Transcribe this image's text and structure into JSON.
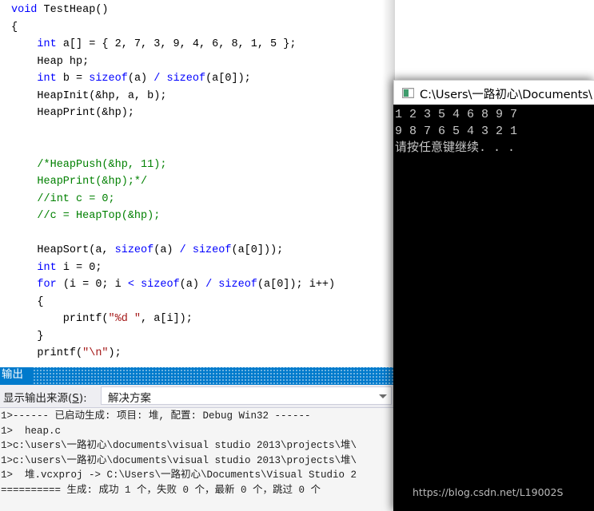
{
  "editor": {
    "language": "c",
    "colors": {
      "keyword": "#0000FF",
      "comment": "#008000",
      "string": "#A31515",
      "plain": "#000000",
      "background": "#FFFFFF"
    },
    "lines": [
      [
        {
          "t": "void ",
          "c": "kw"
        },
        {
          "t": "TestHeap()",
          "c": "pln"
        }
      ],
      [
        {
          "t": "{",
          "c": "pln"
        }
      ],
      [
        {
          "t": "    ",
          "c": "pln"
        },
        {
          "t": "int",
          "c": "kw"
        },
        {
          "t": " a[] = { 2, 7, 3, 9, 4, 6, 8, 1, 5 };",
          "c": "pln"
        }
      ],
      [
        {
          "t": "    Heap hp;",
          "c": "pln"
        }
      ],
      [
        {
          "t": "    ",
          "c": "pln"
        },
        {
          "t": "int",
          "c": "kw"
        },
        {
          "t": " b = ",
          "c": "pln"
        },
        {
          "t": "sizeof",
          "c": "kw"
        },
        {
          "t": "(a) ",
          "c": "pln"
        },
        {
          "t": "/",
          "c": "kw"
        },
        {
          "t": " ",
          "c": "pln"
        },
        {
          "t": "sizeof",
          "c": "kw"
        },
        {
          "t": "(a[0]);",
          "c": "pln"
        }
      ],
      [
        {
          "t": "    HeapInit(&hp, a, b);",
          "c": "pln"
        }
      ],
      [
        {
          "t": "    HeapPrint(&hp);",
          "c": "pln"
        }
      ],
      [
        {
          "t": "",
          "c": "pln"
        }
      ],
      [
        {
          "t": "",
          "c": "pln"
        }
      ],
      [
        {
          "t": "    ",
          "c": "pln"
        },
        {
          "t": "/*HeapPush(&hp, 11);",
          "c": "cmt"
        }
      ],
      [
        {
          "t": "    ",
          "c": "pln"
        },
        {
          "t": "HeapPrint(&hp);*/",
          "c": "cmt"
        }
      ],
      [
        {
          "t": "    ",
          "c": "pln"
        },
        {
          "t": "//int c = 0;",
          "c": "cmt"
        }
      ],
      [
        {
          "t": "    ",
          "c": "pln"
        },
        {
          "t": "//c = HeapTop(&hp);",
          "c": "cmt"
        }
      ],
      [
        {
          "t": "",
          "c": "pln"
        }
      ],
      [
        {
          "t": "    HeapSort(a, ",
          "c": "pln"
        },
        {
          "t": "sizeof",
          "c": "kw"
        },
        {
          "t": "(a) ",
          "c": "pln"
        },
        {
          "t": "/",
          "c": "kw"
        },
        {
          "t": " ",
          "c": "pln"
        },
        {
          "t": "sizeof",
          "c": "kw"
        },
        {
          "t": "(a[0]));",
          "c": "pln"
        }
      ],
      [
        {
          "t": "    ",
          "c": "pln"
        },
        {
          "t": "int",
          "c": "kw"
        },
        {
          "t": " i = 0;",
          "c": "pln"
        }
      ],
      [
        {
          "t": "    ",
          "c": "pln"
        },
        {
          "t": "for",
          "c": "kw"
        },
        {
          "t": " (i = 0; i ",
          "c": "pln"
        },
        {
          "t": "<",
          "c": "kw"
        },
        {
          "t": " ",
          "c": "pln"
        },
        {
          "t": "sizeof",
          "c": "kw"
        },
        {
          "t": "(a) ",
          "c": "pln"
        },
        {
          "t": "/",
          "c": "kw"
        },
        {
          "t": " ",
          "c": "pln"
        },
        {
          "t": "sizeof",
          "c": "kw"
        },
        {
          "t": "(a[0]); i++)",
          "c": "pln"
        }
      ],
      [
        {
          "t": "    {",
          "c": "pln"
        }
      ],
      [
        {
          "t": "        printf(",
          "c": "pln"
        },
        {
          "t": "\"%d \"",
          "c": "str"
        },
        {
          "t": ", a[i]);",
          "c": "pln"
        }
      ],
      [
        {
          "t": "    }",
          "c": "pln"
        }
      ],
      [
        {
          "t": "    printf(",
          "c": "pln"
        },
        {
          "t": "\"\\n\"",
          "c": "str"
        },
        {
          "t": ");",
          "c": "pln"
        }
      ]
    ]
  },
  "output": {
    "tab_title": "输出",
    "source_label_prefix": "显示输出来源(",
    "source_label_accesskey": "S",
    "source_label_suffix": "):",
    "source_value": "解决方案",
    "accent_color": "#007ACC",
    "log_lines": [
      "1>------ 已启动生成: 项目: 堆, 配置: Debug Win32 ------",
      "1>  heap.c",
      "1>c:\\users\\一路初心\\documents\\visual studio 2013\\projects\\堆\\",
      "1>c:\\users\\一路初心\\documents\\visual studio 2013\\projects\\堆\\",
      "1>  堆.vcxproj -> C:\\Users\\一路初心\\Documents\\Visual Studio 2",
      "========== 生成: 成功 1 个，失败 0 个，最新 0 个，跳过 0 个"
    ]
  },
  "console": {
    "title": "C:\\Users\\一路初心\\Documents\\",
    "background": "#000000",
    "text_color": "#C8C8C8",
    "lines": [
      "1 2 3 5 4 6 8 9 7",
      "9 8 7 6 5 4 3 2 1",
      "请按任意键继续. . ."
    ],
    "watermark": "https://blog.csdn.net/L19002S"
  }
}
